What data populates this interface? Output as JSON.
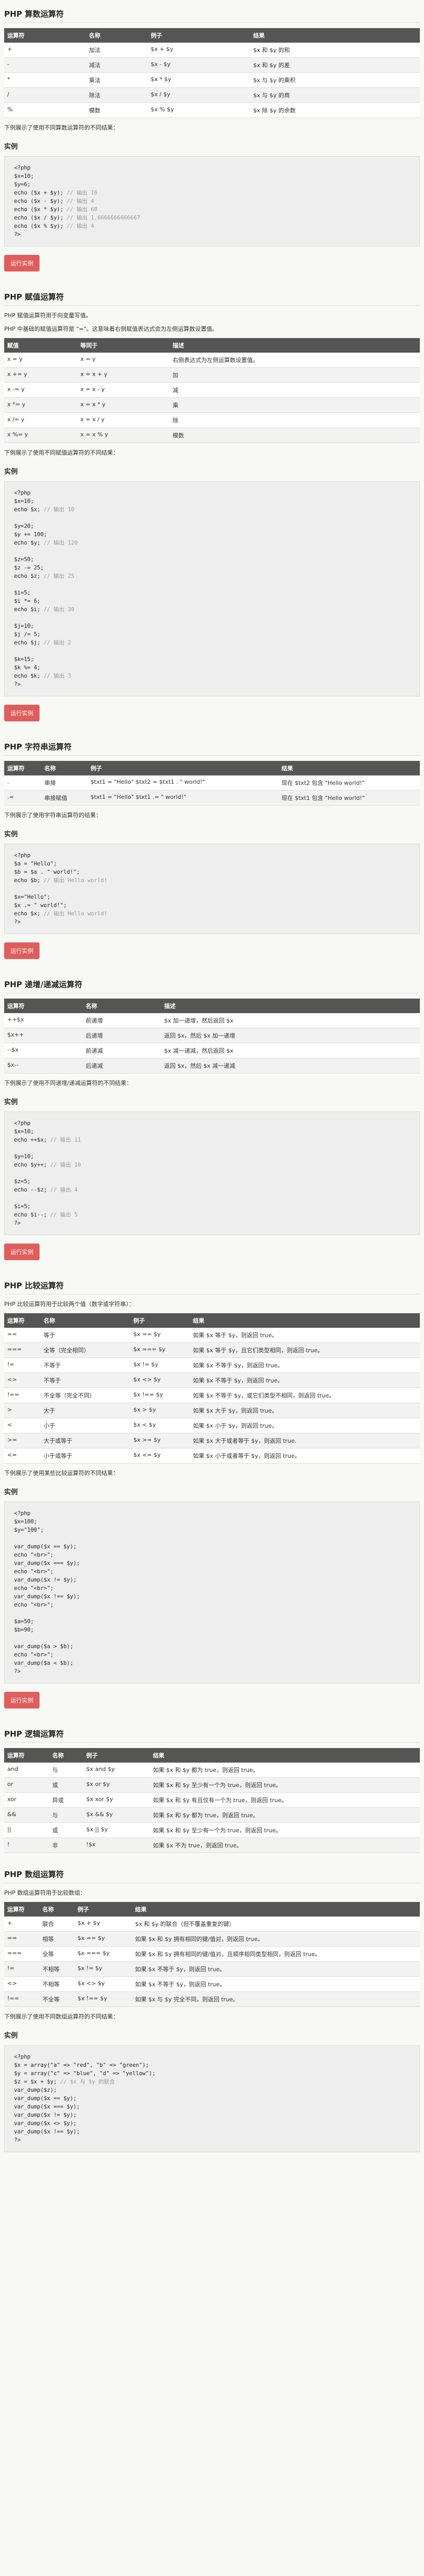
{
  "sections": [
    {
      "title": "PHP 算数运算符",
      "intro": [],
      "headers": [
        "运算符",
        "名称",
        "例子",
        "结果"
      ],
      "rows": [
        [
          "+",
          "加法",
          "$x + $y",
          "$x 和 $y 的和"
        ],
        [
          "-",
          "减法",
          "$x - $y",
          "$x 和 $y 的差"
        ],
        [
          "*",
          "乘法",
          "$x * $y",
          "$x 与 $y 的乘积"
        ],
        [
          "/",
          "除法",
          "$x / $y",
          "$x 与 $y 的商"
        ],
        [
          "%",
          "模数",
          "$x % $y",
          "$x 除 $y 的余数"
        ]
      ],
      "note": "下例展示了使用不同算数运算符的不同结果：",
      "example_title": "实例",
      "code": [
        [
          "<?php",
          ""
        ],
        [
          "$x=10;",
          ""
        ],
        [
          "$y=6;",
          ""
        ],
        [
          "echo ($x + $y);",
          "// 输出 16"
        ],
        [
          "echo ($x - $y);",
          "// 输出 4"
        ],
        [
          "echo ($x * $y);",
          "// 输出 60"
        ],
        [
          "echo ($x / $y);",
          "// 输出 1.6666666666667"
        ],
        [
          "echo ($x % $y);",
          "// 输出 4"
        ],
        [
          "?>",
          ""
        ]
      ],
      "button": "运行实例"
    },
    {
      "title": "PHP 赋值运算符",
      "intro": [
        "PHP 赋值运算符用于向变量写值。",
        "PHP 中基础的赋值运算符是 \"=\"。这意味着右侧赋值表达式会为左侧运算数设置值。"
      ],
      "headers": [
        "赋值",
        "等同于",
        "描述"
      ],
      "rows": [
        [
          "x = y",
          "x = y",
          "右侧表达式为左侧运算数设置值。"
        ],
        [
          "x += y",
          "x = x + y",
          "加"
        ],
        [
          "x -= y",
          "x = x - y",
          "减"
        ],
        [
          "x *= y",
          "x = x * y",
          "乘"
        ],
        [
          "x /= y",
          "x = x / y",
          "除"
        ],
        [
          "x %= y",
          "x = x % y",
          "模数"
        ]
      ],
      "note": "下例展示了使用不同赋值运算符的不同结果：",
      "example_title": "实例",
      "code": [
        [
          "<?php",
          ""
        ],
        [
          "$x=10;",
          ""
        ],
        [
          "echo $x;",
          "// 输出 10"
        ],
        [
          "",
          ""
        ],
        [
          "$y=20;",
          ""
        ],
        [
          "$y += 100;",
          ""
        ],
        [
          "echo $y;",
          "// 输出 120"
        ],
        [
          "",
          ""
        ],
        [
          "$z=50;",
          ""
        ],
        [
          "$z -= 25;",
          ""
        ],
        [
          "echo $z;",
          "// 输出 25"
        ],
        [
          "",
          ""
        ],
        [
          "$i=5;",
          ""
        ],
        [
          "$i *= 6;",
          ""
        ],
        [
          "echo $i;",
          "// 输出 30"
        ],
        [
          "",
          ""
        ],
        [
          "$j=10;",
          ""
        ],
        [
          "$j /= 5;",
          ""
        ],
        [
          "echo $j;",
          "// 输出 2"
        ],
        [
          "",
          ""
        ],
        [
          "$k=15;",
          ""
        ],
        [
          "$k %= 4;",
          ""
        ],
        [
          "echo $k;",
          "// 输出 3"
        ],
        [
          "?>",
          ""
        ]
      ],
      "button": "运行实例"
    },
    {
      "title": "PHP 字符串运算符",
      "intro": [],
      "headers": [
        "运算符",
        "名称",
        "例子",
        "结果"
      ],
      "rows": [
        [
          ".",
          "串接",
          "$txt1 = \"Hello\" $txt2 = $txt1 . \" world!\"",
          "现在 $txt2 包含 \"Hello world!\""
        ],
        [
          ".=",
          "串接赋值",
          "$txt1 = \"Hello\" $txt1 .= \" world!\"",
          "现在 $txt1 包含 \"Hello world!\""
        ]
      ],
      "note": "下例展示了使用字符串运算符的结果：",
      "example_title": "实例",
      "code": [
        [
          "<?php",
          ""
        ],
        [
          "$a = \"Hello\";",
          ""
        ],
        [
          "$b = $a . \" world!\";",
          ""
        ],
        [
          "echo $b;",
          "// 输出 Hello world!"
        ],
        [
          "",
          ""
        ],
        [
          "$x=\"Hello\";",
          ""
        ],
        [
          "$x .= \" world!\";",
          ""
        ],
        [
          "echo $x;",
          "// 输出 Hello world!"
        ],
        [
          "?>",
          ""
        ]
      ],
      "button": "运行实例"
    },
    {
      "title": "PHP 递增/递减运算符",
      "intro": [],
      "headers": [
        "运算符",
        "名称",
        "描述"
      ],
      "rows": [
        [
          "++$x",
          "前递增",
          "$x 加一递增，然后返回 $x"
        ],
        [
          "$x++",
          "后递增",
          "返回 $x，然后 $x 加一递增"
        ],
        [
          "--$x",
          "前递减",
          "$x 减一递减，然后返回 $x"
        ],
        [
          "$x--",
          "后递减",
          "返回 $x，然后 $x 减一递减"
        ]
      ],
      "note": "下例展示了使用不同递增/递减运算符的不同结果：",
      "example_title": "实例",
      "code": [
        [
          "<?php",
          ""
        ],
        [
          "$x=10;",
          ""
        ],
        [
          "echo ++$x;",
          "// 输出 11"
        ],
        [
          "",
          ""
        ],
        [
          "$y=10;",
          ""
        ],
        [
          "echo $y++;",
          "// 输出 10"
        ],
        [
          "",
          ""
        ],
        [
          "$z=5;",
          ""
        ],
        [
          "echo --$z;",
          "// 输出 4"
        ],
        [
          "",
          ""
        ],
        [
          "$i=5;",
          ""
        ],
        [
          "echo $i--;",
          "// 输出 5"
        ],
        [
          "?>",
          ""
        ]
      ],
      "button": "运行实例"
    },
    {
      "title": "PHP 比较运算符",
      "intro": [
        "PHP 比较运算符用于比较两个值（数字或字符串）："
      ],
      "headers": [
        "运算符",
        "名称",
        "例子",
        "结果"
      ],
      "rows": [
        [
          "==",
          "等于",
          "$x == $y",
          "如果 $x 等于 $y，则返回 true。"
        ],
        [
          "===",
          "全等（完全相同）",
          "$x === $y",
          "如果 $x 等于 $y，且它们类型相同，则返回 true。"
        ],
        [
          "!=",
          "不等于",
          "$x != $y",
          "如果 $x 不等于 $y，则返回 true。"
        ],
        [
          "<>",
          "不等于",
          "$x <> $y",
          "如果 $x 不等于 $y，则返回 true。"
        ],
        [
          "!==",
          "不全等（完全不同）",
          "$x !== $y",
          "如果 $x 不等于 $y，或它们类型不相同，则返回 true。"
        ],
        [
          ">",
          "大于",
          "$x > $y",
          "如果 $x 大于 $y，则返回 true。"
        ],
        [
          "<",
          "小于",
          "$x < $y",
          "如果 $x 小于 $y，则返回 true。"
        ],
        [
          ">=",
          "大于或等于",
          "$x >= $y",
          "如果 $x 大于或者等于 $y，则返回 true."
        ],
        [
          "<=",
          "小于或等于",
          "$x <= $y",
          "如果 $x 小于或者等于 $y，则返回 true。"
        ]
      ],
      "note": "下例展示了使用某些比较运算符的不同结果：",
      "example_title": "实例",
      "code": [
        [
          "<?php",
          ""
        ],
        [
          "$x=100;",
          ""
        ],
        [
          "$y=\"100\";",
          ""
        ],
        [
          "",
          ""
        ],
        [
          "var_dump($x == $y);",
          ""
        ],
        [
          "echo \"<br>\";",
          ""
        ],
        [
          "var_dump($x === $y);",
          ""
        ],
        [
          "echo \"<br>\";",
          ""
        ],
        [
          "var_dump($x != $y);",
          ""
        ],
        [
          "echo \"<br>\";",
          ""
        ],
        [
          "var_dump($x !== $y);",
          ""
        ],
        [
          "echo \"<br>\";",
          ""
        ],
        [
          "",
          ""
        ],
        [
          "$a=50;",
          ""
        ],
        [
          "$b=90;",
          ""
        ],
        [
          "",
          ""
        ],
        [
          "var_dump($a > $b);",
          ""
        ],
        [
          "echo \"<br>\";",
          ""
        ],
        [
          "var_dump($a < $b);",
          ""
        ],
        [
          "?>",
          ""
        ]
      ],
      "button": "运行实例"
    },
    {
      "title": "PHP 逻辑运算符",
      "intro": [],
      "headers": [
        "运算符",
        "名称",
        "例子",
        "结果"
      ],
      "rows": [
        [
          "and",
          "与",
          "$x and $y",
          "如果 $x 和 $y 都为 true，则返回 true。"
        ],
        [
          "or",
          "或",
          "$x or $y",
          "如果 $x 和 $y 至少有一个为 true，则返回 true。"
        ],
        [
          "xor",
          "异或",
          "$x xor $y",
          "如果 $x 和 $y 有且仅有一个为 true，则返回 true。"
        ],
        [
          "&&",
          "与",
          "$x && $y",
          "如果 $x 和 $y 都为 true，则返回 true。"
        ],
        [
          "||",
          "或",
          "$x || $y",
          "如果 $x 和 $y 至少有一个为 true，则返回 true。"
        ],
        [
          "!",
          "非",
          "!$x",
          "如果 $x 不为 true，则返回 true。"
        ]
      ],
      "note": "",
      "example_title": "",
      "code": [],
      "button": ""
    },
    {
      "title": "PHP 数组运算符",
      "intro": [
        "PHP 数组运算符用于比较数组："
      ],
      "headers": [
        "运算符",
        "名称",
        "例子",
        "结果"
      ],
      "rows": [
        [
          "+",
          "联合",
          "$x + $y",
          "$x 和 $y 的联合（但不覆盖重复的键）"
        ],
        [
          "==",
          "相等",
          "$x == $y",
          "如果 $x 和 $y 拥有相同的键/值对，则返回 true。"
        ],
        [
          "===",
          "全等",
          "$x === $y",
          "如果 $x 和 $y 拥有相同的键/值对，且顺序相同类型相同，则返回 true。"
        ],
        [
          "!=",
          "不相等",
          "$x != $y",
          "如果 $x 不等于 $y，则返回 true。"
        ],
        [
          "<>",
          "不相等",
          "$x <> $y",
          "如果 $x 不等于 $y，则返回 true。"
        ],
        [
          "!==",
          "不全等",
          "$x !== $y",
          "如果 $x 与 $y 完全不同，则返回 true。"
        ]
      ],
      "note": "下例展示了使用不同数组运算符的不同结果：",
      "example_title": "实例",
      "code": [
        [
          "<?php",
          ""
        ],
        [
          "$x = array(\"a\" => \"red\", \"b\" => \"green\");",
          ""
        ],
        [
          "$y = array(\"c\" => \"blue\", \"d\" => \"yellow\");",
          ""
        ],
        [
          "$z = $x + $y;",
          "// $x 与 $y 的联合"
        ],
        [
          "var_dump($z);",
          ""
        ],
        [
          "var_dump($x == $y);",
          ""
        ],
        [
          "var_dump($x === $y);",
          ""
        ],
        [
          "var_dump($x != $y);",
          ""
        ],
        [
          "var_dump($x <> $y);",
          ""
        ],
        [
          "var_dump($x !== $y);",
          ""
        ],
        [
          "?>",
          ""
        ]
      ],
      "button": ""
    }
  ]
}
